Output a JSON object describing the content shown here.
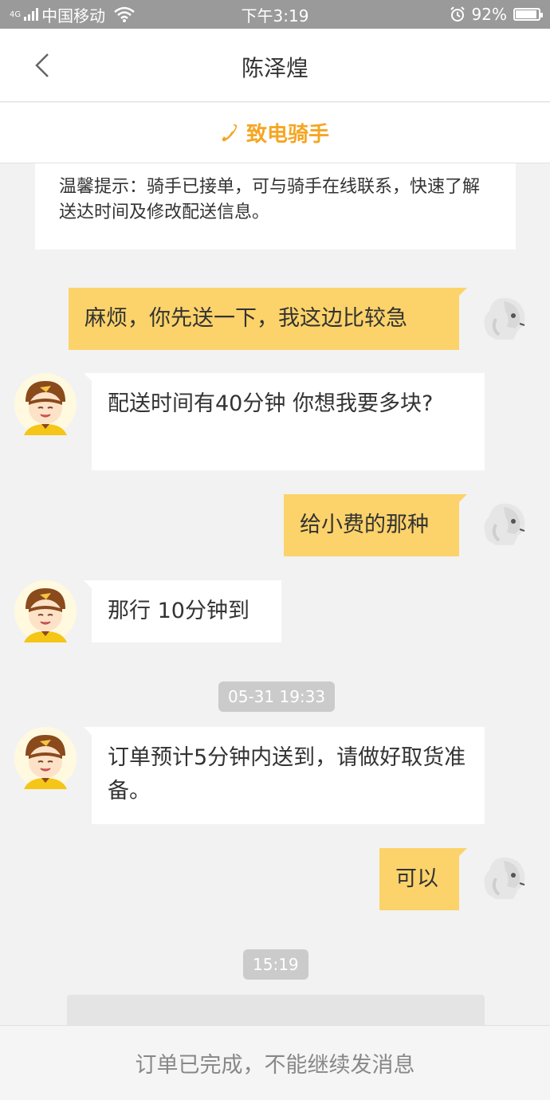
{
  "status_bar": {
    "network_type": "4G",
    "carrier": "中国移动",
    "time": "下午3:19",
    "battery_percent": "92%",
    "battery_level": 0.92,
    "icons": [
      "signal-icon",
      "wifi-icon",
      "alarm-icon",
      "battery-icon"
    ]
  },
  "header": {
    "back_icon": "chevron-left-icon",
    "title": "陈泽煌"
  },
  "call_bar": {
    "icon": "phone-icon",
    "label": "致电骑手",
    "color": "#f5a623"
  },
  "tip": {
    "text": "温馨提示：骑手已接单，可与骑手在线联系，快速了解送达时间及修改配送信息。"
  },
  "messages": [
    {
      "sender": "me",
      "text": "麻烦，你先送一下，我这边比较急"
    },
    {
      "sender": "rider",
      "text": "配送时间有40分钟  你想我要多块?"
    },
    {
      "sender": "me",
      "text": "给小费的那种"
    },
    {
      "sender": "rider",
      "text": "那行  10分钟到"
    },
    {
      "sender": "system_time",
      "text": "05-31 19:33"
    },
    {
      "sender": "rider",
      "text": "订单预计5分钟内送到，请做好取货准备。"
    },
    {
      "sender": "me",
      "text": "可以"
    },
    {
      "sender": "system_time",
      "text": "15:19"
    }
  ],
  "bottom_bar": {
    "text": "订单已完成，不能继续发消息"
  },
  "colors": {
    "my_bubble": "#fcd36a",
    "rider_bubble": "#ffffff",
    "background": "#f2f2f2",
    "accent": "#f5a623"
  }
}
